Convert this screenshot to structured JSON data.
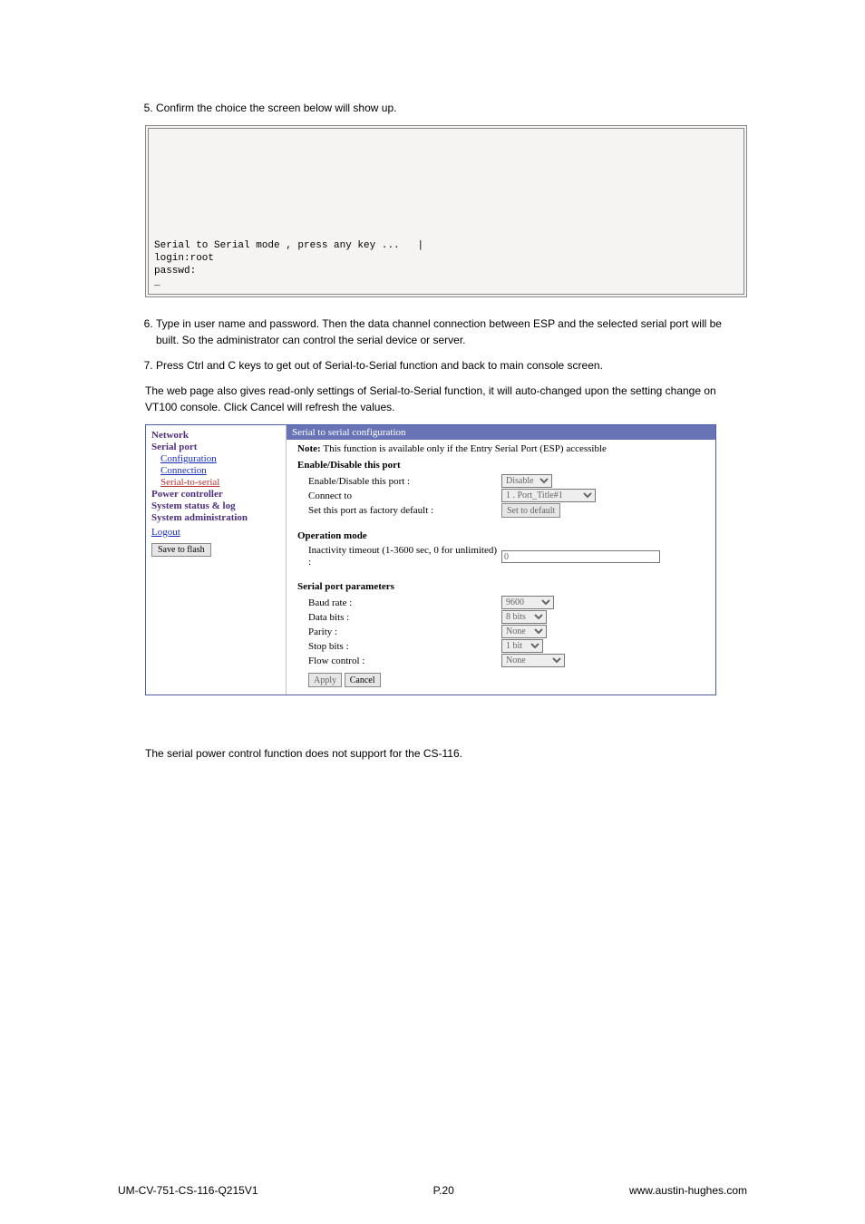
{
  "step5": "Confirm the choice the screen below will show up.",
  "terminal": {
    "line1": "Serial to Serial mode , press any key ...   |",
    "line2": "login:root",
    "line3": "passwd:",
    "line4": "_"
  },
  "step6": "Type in user name and password. Then the data channel connection between ESP and the selected serial port will be built. So the administrator can control the serial device or server.",
  "step7": "Press Ctrl and C keys to get out of Serial-to-Serial function and back to main console screen.",
  "para1": "The web page also gives read-only settings of Serial-to-Serial function, it will auto-changed upon the setting change on VT100 console. Click Cancel will refresh the values.",
  "sidebar": {
    "network": "Network",
    "serialport": "Serial port",
    "configuration": "Configuration",
    "connection": "Connection",
    "serialtoserial": "Serial-to-serial",
    "powercontroller": "Power controller",
    "systemstatus": "System status & log",
    "systemadmin": "System administration",
    "logout": "Logout",
    "savetoflash": "Save to flash"
  },
  "content": {
    "title": "Serial to serial configuration",
    "note_pref": "Note: ",
    "note_body": "This function is available only if the Entry Serial Port (ESP) accessible",
    "sect1": "Enable/Disable this port",
    "enable_label": "Enable/Disable this port :",
    "enable_val": "Disable",
    "connect_label": "Connect to",
    "connect_val": "1 . Port_Title#1",
    "factory_label": "Set this port as factory default :",
    "factory_btn": "Set to default",
    "sect2": "Operation mode",
    "inactivity_label": "Inactivity timeout (1-3600 sec, 0 for unlimited) :",
    "inactivity_val": "0",
    "sect3": "Serial port parameters",
    "baud_label": "Baud rate :",
    "baud_val": "9600",
    "data_label": "Data bits :",
    "data_val": "8 bits",
    "parity_label": "Parity :",
    "parity_val": "None",
    "stop_label": "Stop bits :",
    "stop_val": "1 bit",
    "flow_label": "Flow control :",
    "flow_val": "None",
    "apply": "Apply",
    "cancel": "Cancel"
  },
  "final": "The serial power control function does not support for the CS-116.",
  "footer": {
    "left": "UM-CV-751-CS-116-Q215V1",
    "center": "P.20",
    "right": "www.austin-hughes.com"
  }
}
